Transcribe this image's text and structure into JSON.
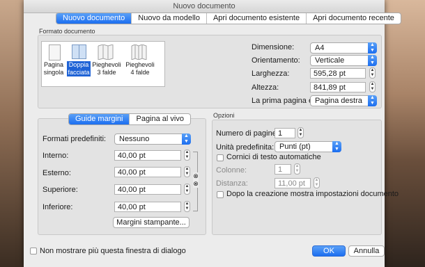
{
  "window": {
    "title": "Nuovo documento"
  },
  "tabs": [
    {
      "label": "Nuovo documento",
      "active": true
    },
    {
      "label": "Nuovo da modello",
      "active": false
    },
    {
      "label": "Apri documento esistente",
      "active": false
    },
    {
      "label": "Apri documento recente",
      "active": false
    }
  ],
  "format": {
    "group_label": "Formato documento",
    "layouts": [
      {
        "line1": "Pagina",
        "line2": "singola",
        "selected": false
      },
      {
        "line1": "Doppia",
        "line2": "facciata",
        "selected": true
      },
      {
        "line1": "Pieghevoli",
        "line2": "3 falde",
        "selected": false
      },
      {
        "line1": "Pieghevoli",
        "line2": "4 falde",
        "selected": false
      }
    ],
    "dimension_label": "Dimensione:",
    "dimension_value": "A4",
    "orientation_label": "Orientamento:",
    "orientation_value": "Verticale",
    "width_label": "Larghezza:",
    "width_value": "595,28 pt",
    "height_label": "Altezza:",
    "height_value": "841,89 pt",
    "first_page_label": "La prima pagina è:",
    "first_page_value": "Pagina destra"
  },
  "margins": {
    "tabs": [
      {
        "label": "Guide margini",
        "active": true
      },
      {
        "label": "Pagina al vivo",
        "active": false
      }
    ],
    "presets_label": "Formati predefiniti:",
    "presets_value": "Nessuno",
    "inner_label": "Interno:",
    "inner_value": "40,00 pt",
    "outer_label": "Esterno:",
    "outer_value": "40,00 pt",
    "top_label": "Superiore:",
    "top_value": "40,00 pt",
    "bottom_label": "Inferiore:",
    "bottom_value": "40,00 pt",
    "print_margins_button": "Margini stampante..."
  },
  "options": {
    "group_label": "Opzioni",
    "pages_label": "Numero di pagine:",
    "pages_value": "1",
    "unit_label": "Unità predefinita:",
    "unit_value": "Punti (pt)",
    "auto_frames_label": "Cornici di testo automatiche",
    "columns_label": "Colonne:",
    "columns_value": "1",
    "distance_label": "Distanza:",
    "distance_value": "11,00 pt",
    "show_settings_label": "Dopo la creazione mostra impostazioni documento"
  },
  "footer": {
    "dont_show_label": "Non mostrare più questa finestra di dialogo",
    "ok_label": "OK",
    "cancel_label": "Annulla"
  }
}
